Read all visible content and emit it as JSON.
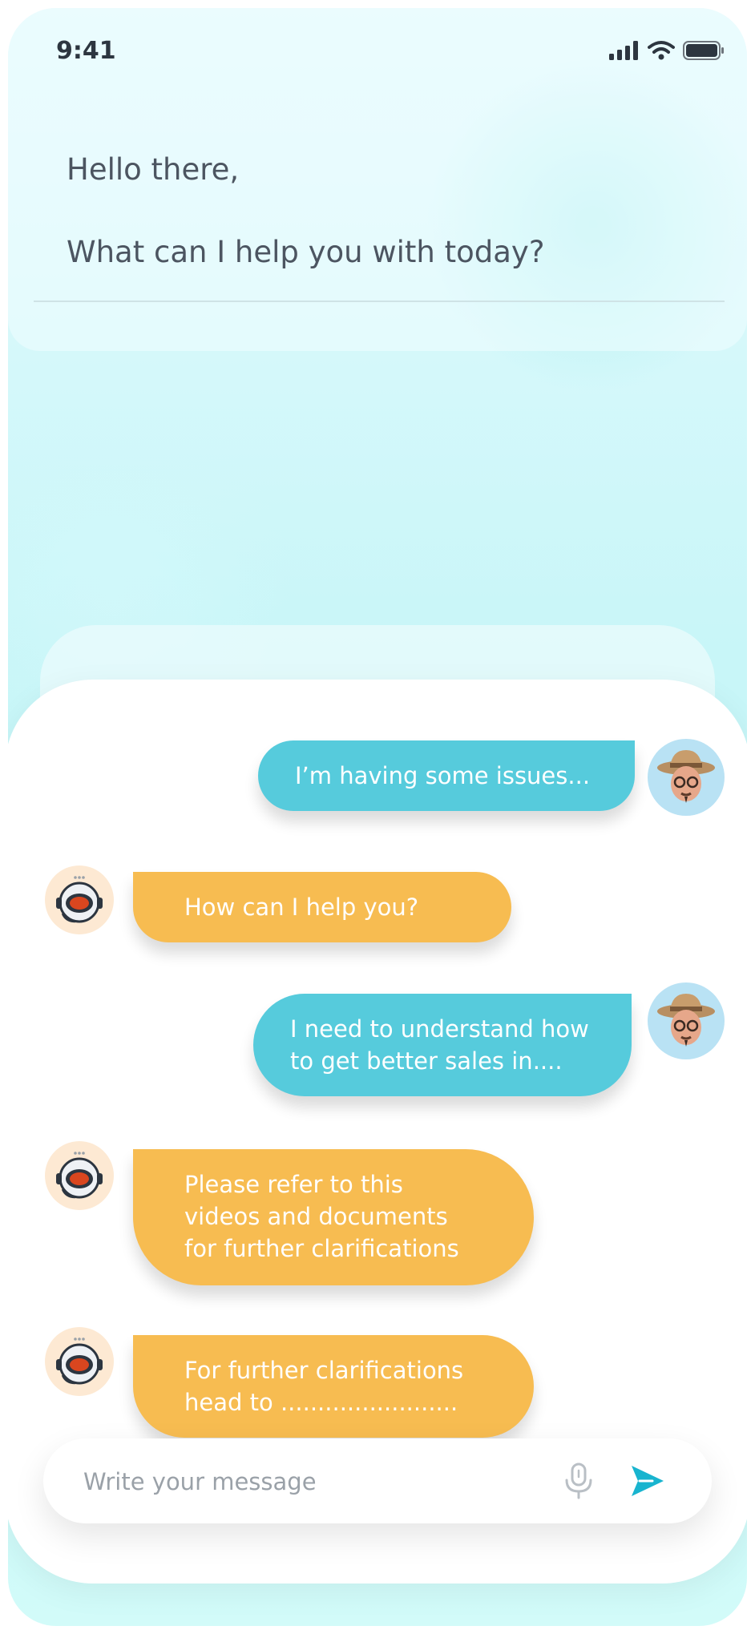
{
  "status_bar": {
    "time": "9:41"
  },
  "header": {
    "greeting": "Hello there,",
    "question": "What can I help you with today?"
  },
  "messages": [
    {
      "sender": "user",
      "lines": [
        "I’m having some issues..."
      ]
    },
    {
      "sender": "bot",
      "lines": [
        "How can I help you?"
      ]
    },
    {
      "sender": "user",
      "lines": [
        "I need to understand how",
        "to get better sales in...."
      ]
    },
    {
      "sender": "bot",
      "lines": [
        "Please refer to this",
        "videos and documents",
        "for further clarifications"
      ]
    },
    {
      "sender": "bot",
      "lines": [
        "For further clarifications",
        "head to ........................"
      ]
    }
  ],
  "composer": {
    "placeholder": "Write your message"
  },
  "icons": {
    "mic": "microphone-icon",
    "send": "send-icon",
    "user_avatar": "user-avatar",
    "bot_avatar": "support-bot-avatar"
  },
  "colors": {
    "user_bubble": "#56cbdc",
    "bot_bubble": "#f7bc51",
    "accent": "#18b4cf"
  }
}
